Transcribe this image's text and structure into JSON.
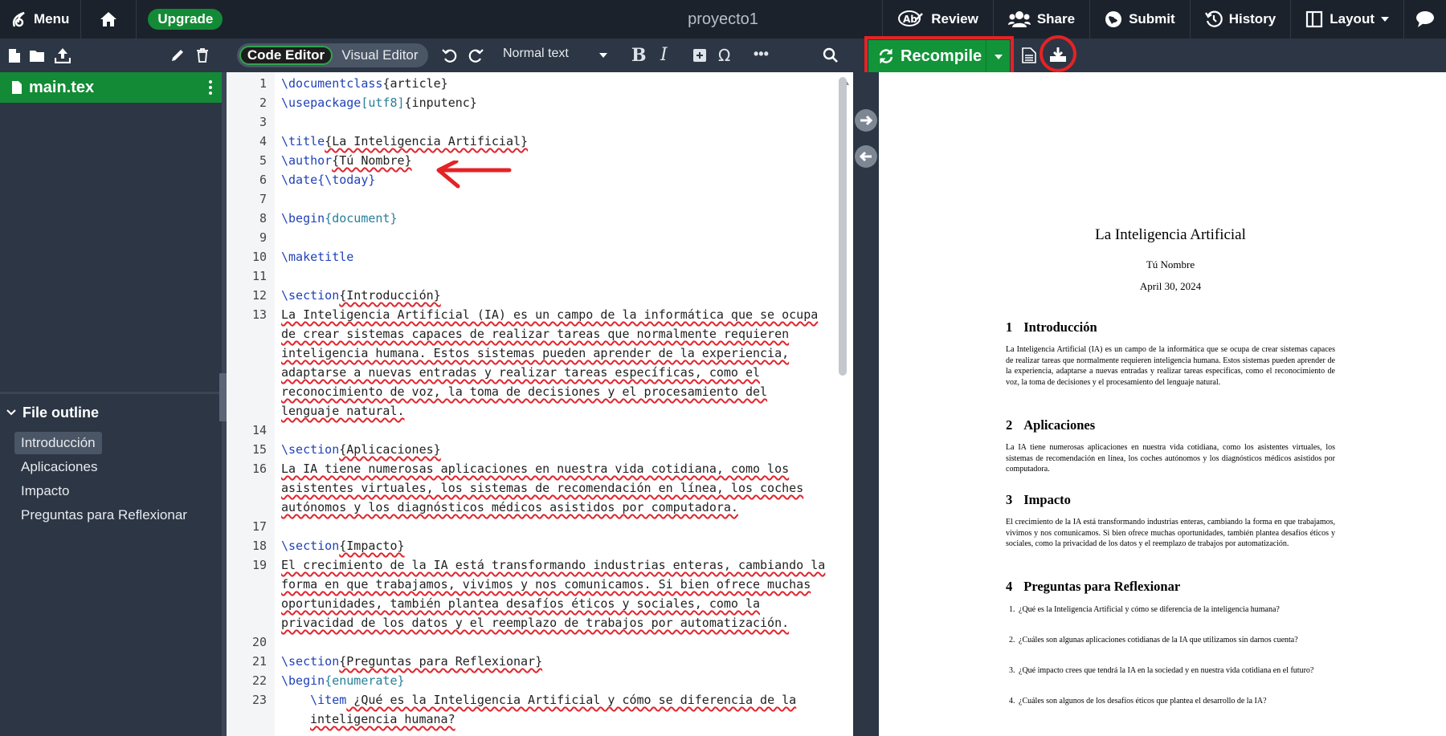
{
  "topbar": {
    "menu_label": "Menu",
    "upgrade_label": "Upgrade",
    "project_title": "proyecto1",
    "review_label": "Review",
    "share_label": "Share",
    "submit_label": "Submit",
    "history_label": "History",
    "layout_label": "Layout"
  },
  "toolbar": {
    "code_editor_label": "Code Editor",
    "visual_editor_label": "Visual Editor",
    "text_style": "Normal text",
    "recompile_label": "Recompile"
  },
  "sidebar": {
    "file_name": "main.tex",
    "outline_title": "File outline",
    "outline_items": [
      "Introducción",
      "Aplicaciones",
      "Impacto",
      "Preguntas para Reflexionar"
    ]
  },
  "editor": {
    "line_numbers": [
      "1",
      "2",
      "3",
      "4",
      "5",
      "6",
      "7",
      "8",
      "9",
      "10",
      "11",
      "12",
      "13",
      "14",
      "15",
      "16",
      "17",
      "18",
      "19",
      "20",
      "21",
      "22",
      "23"
    ],
    "code": {
      "l1_cmd": "\\documentclass",
      "l1_rest": "{article}",
      "l2_cmd": "\\usepackage",
      "l2_opt": "[utf8]",
      "l2_rest": "{inputenc}",
      "l4_cmd": "\\title",
      "l4_rest": "{La Inteligencia Artificial}",
      "l5_cmd": "\\author",
      "l5_rest": "{Tú Nombre}",
      "l6_cmd": "\\date",
      "l6_arg": "{\\today}",
      "l8_cmd": "\\begin",
      "l8_arg": "{document}",
      "l10_cmd": "\\maketitle",
      "l12_cmd": "\\section",
      "l12_rest": "{Introducción}",
      "l13_a": "La Inteligencia Artificial (IA) es un campo de la informática que se ocupa",
      "l13_b": "de crear sistemas capaces de realizar tareas que normalmente requieren",
      "l13_c": "inteligencia humana. Estos sistemas pueden aprender de la experiencia,",
      "l13_d": "adaptarse a nuevas entradas y realizar tareas específicas, como el",
      "l13_e": "reconocimiento de voz, la toma de decisiones y el procesamiento del",
      "l13_f": "lenguaje natural.",
      "l15_cmd": "\\section",
      "l15_rest": "{Aplicaciones}",
      "l16_a": "La IA tiene numerosas aplicaciones en nuestra vida cotidiana, como los",
      "l16_b": "asistentes virtuales, los sistemas de recomendación en línea, los coches",
      "l16_c": "autónomos y los diagnósticos médicos asistidos por computadora.",
      "l18_cmd": "\\section",
      "l18_rest": "{Impacto}",
      "l19_a": "El crecimiento de la IA está transformando industrias enteras, cambiando la",
      "l19_b": "forma en que trabajamos, vivimos y nos comunicamos. Si bien ofrece muchas",
      "l19_c": "oportunidades, también plantea desafíos éticos y sociales, como la",
      "l19_d": "privacidad de los datos y el reemplazo de trabajos por automatización.",
      "l21_cmd": "\\section",
      "l21_rest": "{Preguntas para Reflexionar}",
      "l22_cmd": "\\begin",
      "l22_arg": "{enumerate}",
      "l23_cmd": "\\item",
      "l23_a": " ¿Qué es la Inteligencia Artificial y cómo se diferencia de la",
      "l23_b": "inteligencia humana?"
    }
  },
  "pdf": {
    "title": "La Inteligencia Artificial",
    "author": "Tú Nombre",
    "date": "April 30, 2024",
    "sections": [
      {
        "num": "1",
        "title": "Introducción",
        "body": "La Inteligencia Artificial (IA) es un campo de la informática que se ocupa de crear sistemas capaces de realizar tareas que normalmente requieren inteligencia humana. Estos sistemas pueden aprender de la experiencia, adaptarse a nuevas entradas y realizar tareas específicas, como el reconocimiento de voz, la toma de decisiones y el procesamiento del lenguaje natural."
      },
      {
        "num": "2",
        "title": "Aplicaciones",
        "body": "La IA tiene numerosas aplicaciones en nuestra vida cotidiana, como los asistentes virtuales, los sistemas de recomendación en línea, los coches autónomos y los diagnósticos médicos asistidos por computadora."
      },
      {
        "num": "3",
        "title": "Impacto",
        "body": "El crecimiento de la IA está transformando industrias enteras, cambiando la forma en que trabajamos, vivimos y nos comunicamos. Si bien ofrece muchas oportunidades, también plantea desafíos éticos y sociales, como la privacidad de los datos y el reemplazo de trabajos por automatización."
      },
      {
        "num": "4",
        "title": "Preguntas para Reflexionar",
        "body": ""
      }
    ],
    "questions": [
      "¿Qué es la Inteligencia Artificial y cómo se diferencia de la inteligencia humana?",
      "¿Cuáles son algunas aplicaciones cotidianas de la IA que utilizamos sin darnos cuenta?",
      "¿Qué impacto crees que tendrá la IA en la sociedad y en nuestra vida cotidiana en el futuro?",
      "¿Cuáles son algunos de los desafíos éticos que plantea el desarrollo de la IA?"
    ],
    "question_nums": [
      "1.",
      "2.",
      "3.",
      "4."
    ]
  },
  "colors": {
    "green": "#138a36",
    "highlight_red": "#e52225",
    "dark_bg": "#1b222c",
    "panel_bg": "#2c3645"
  },
  "icons": [
    "overleaf-logo-icon",
    "home-icon",
    "review-icon",
    "share-icon",
    "submit-icon",
    "history-icon",
    "layout-icon",
    "chat-icon",
    "new-file-icon",
    "new-folder-icon",
    "upload-icon",
    "rename-icon",
    "delete-icon",
    "undo-icon",
    "redo-icon",
    "bold-icon",
    "italic-icon",
    "insert-figure-icon",
    "symbol-icon",
    "more-icon",
    "search-icon",
    "refresh-icon",
    "caret-down-icon",
    "pdf-logs-icon",
    "download-pdf-icon",
    "arrow-right-icon",
    "arrow-left-icon"
  ]
}
